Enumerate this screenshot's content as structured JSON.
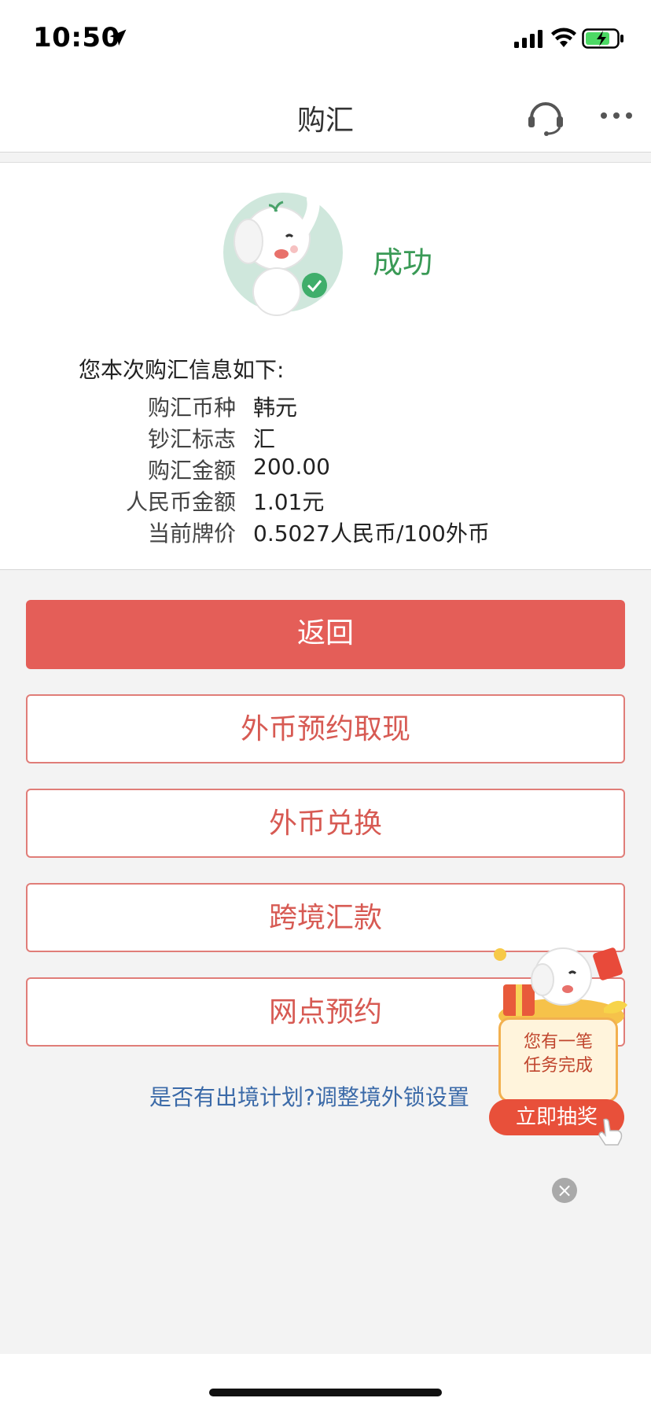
{
  "status_bar": {
    "time": "10:50",
    "icons": [
      "location-arrow-icon",
      "signal-icon",
      "wifi-icon",
      "battery-charging-icon"
    ],
    "battery_color": "#4cd964"
  },
  "nav": {
    "title": "购汇",
    "icons": [
      "headset-icon",
      "more-icon"
    ]
  },
  "result": {
    "status": "成功",
    "status_color": "#3a9a56",
    "info_title": "您本次购汇信息如下:",
    "rows": [
      {
        "label": "购汇币种",
        "value": "韩元"
      },
      {
        "label": "钞汇标志",
        "value": "汇"
      },
      {
        "label": "购汇金额",
        "value": "200.00"
      },
      {
        "label": "人民币金额",
        "value": "1.01元"
      },
      {
        "label": "当前牌价",
        "value": "0.5027人民币/100外币"
      }
    ],
    "colon": ":"
  },
  "buttons": {
    "back": "返回",
    "fx_withdraw_appointment": "外币预约取现",
    "fx_exchange": "外币兑换",
    "cross_border_remit": "跨境汇款",
    "branch_appointment": "网点预约"
  },
  "link": {
    "text": "是否有出境计划?调整境外锁设置"
  },
  "promo": {
    "line1": "您有一笔",
    "line2": "任务完成",
    "button": "立即抽奖",
    "close": "×"
  },
  "colors": {
    "primary": "#e45e58",
    "link": "#3b6aa8"
  }
}
